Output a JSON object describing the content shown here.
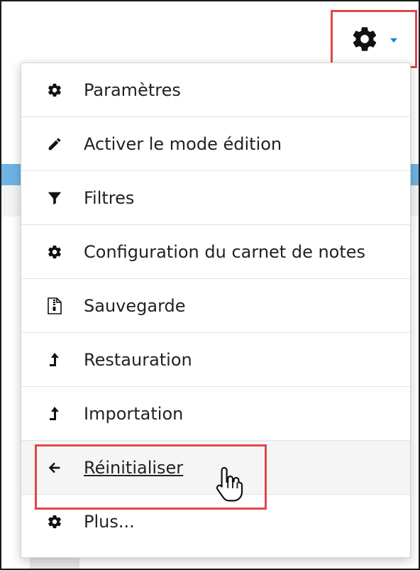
{
  "toggle": {
    "icon": "gear-icon",
    "caret_icon": "caret-down-icon",
    "accent_color": "#1a87cf",
    "highlight_color": "#e0474c"
  },
  "menu": {
    "items": [
      {
        "label": "Paramètres",
        "icon": "gear-icon"
      },
      {
        "label": "Activer le mode édition",
        "icon": "pencil-icon"
      },
      {
        "label": "Filtres",
        "icon": "filter-icon"
      },
      {
        "label": "Configuration du carnet de notes",
        "icon": "gear-icon"
      },
      {
        "label": "Sauvegarde",
        "icon": "file-archive-icon"
      },
      {
        "label": "Restauration",
        "icon": "level-up-icon"
      },
      {
        "label": "Importation",
        "icon": "level-up-icon"
      },
      {
        "label": "Réinitialiser",
        "icon": "arrow-left-icon",
        "active": true
      },
      {
        "label": "Plus...",
        "icon": "gear-icon"
      }
    ]
  }
}
